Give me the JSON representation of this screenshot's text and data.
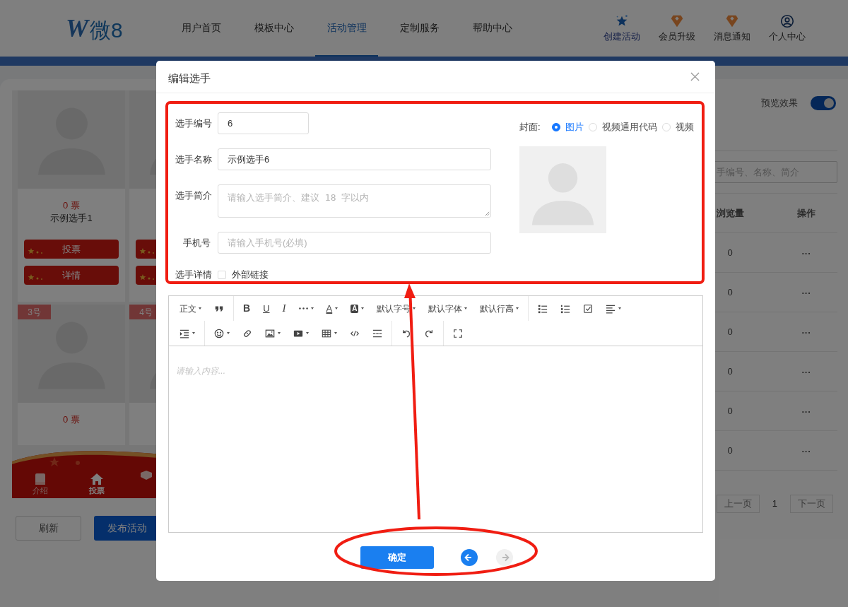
{
  "header": {
    "logo_mark": "W",
    "logo_text": "微8",
    "nav": [
      {
        "label": "用户首页",
        "selected": false
      },
      {
        "label": "模板中心",
        "selected": false
      },
      {
        "label": "活动管理",
        "selected": true
      },
      {
        "label": "定制服务",
        "selected": false
      },
      {
        "label": "帮助中心",
        "selected": false
      }
    ],
    "actions": [
      {
        "label": "创建活动"
      },
      {
        "label": "会员升级"
      },
      {
        "label": "消息通知"
      },
      {
        "label": "个人中心"
      }
    ]
  },
  "preview": {
    "cards": [
      {
        "kind": "full",
        "votes": "0 票",
        "name": "示例选手1",
        "buttons": [
          "投票",
          "详情"
        ]
      },
      {
        "kind": "covered"
      },
      {
        "kind": "badge",
        "badge": "3号",
        "votes": "0 票"
      },
      {
        "kind": "badge",
        "badge": "4号"
      }
    ],
    "tabs": [
      {
        "label": "介绍",
        "selected": false
      },
      {
        "label": "投票",
        "selected": true
      }
    ]
  },
  "actions": {
    "refresh": "刷新",
    "publish": "发布活动"
  },
  "preview_toggle": {
    "label": "预览效果",
    "on": true
  },
  "search": {
    "placeholder": "手编号、名称、简介"
  },
  "table": {
    "columns": [
      "浏览量",
      "操作"
    ],
    "rows": [
      {
        "views": "0",
        "actions": "···"
      },
      {
        "views": "0",
        "actions": "···"
      },
      {
        "views": "0",
        "actions": "···"
      },
      {
        "views": "0",
        "actions": "···"
      },
      {
        "views": "0",
        "actions": "···"
      },
      {
        "views": "0",
        "actions": "···"
      }
    ]
  },
  "pagination": {
    "prev": "上一页",
    "page": "1",
    "next": "下一页"
  },
  "dialog": {
    "title": "编辑选手",
    "fields": [
      {
        "kind": "short",
        "label": "选手编号",
        "value": "6"
      },
      {
        "kind": "text",
        "label": "选手名称",
        "value": "示例选手6"
      },
      {
        "kind": "textarea",
        "label": "选手简介",
        "placeholder": "请输入选手简介、建议 18 字以内"
      },
      {
        "kind": "text",
        "label": "手机号",
        "placeholder": "请输入手机号(必填)"
      }
    ],
    "detail": {
      "label": "选手详情",
      "checkbox": {
        "label": "外部链接",
        "checked": false
      }
    },
    "cover": {
      "label": "封面:",
      "options": [
        {
          "label": "图片",
          "selected": true
        },
        {
          "label": "视频通用代码",
          "selected": false
        },
        {
          "label": "视频",
          "selected": false
        }
      ]
    },
    "editor": {
      "toolbar": [
        [
          {
            "kind": "menu",
            "label": "正文"
          },
          {
            "kind": "icon"
          },
          {
            "kind": "sep"
          },
          {
            "kind": "glyph",
            "label": "B"
          },
          {
            "kind": "glyph",
            "label": "U"
          },
          {
            "kind": "glyph",
            "label": "I"
          },
          {
            "kind": "icon",
            "dropdown": true
          },
          {
            "kind": "glyph",
            "label": "A",
            "dropdown": true
          },
          {
            "kind": "glyph",
            "label": "A",
            "dropdown": true
          },
          {
            "kind": "menu",
            "label": "默认字号"
          },
          {
            "kind": "menu",
            "label": "默认字体"
          },
          {
            "kind": "menu",
            "label": "默认行高"
          },
          {
            "kind": "sep"
          },
          {
            "kind": "icon"
          },
          {
            "kind": "icon"
          },
          {
            "kind": "icon"
          },
          {
            "kind": "icon",
            "dropdown": true
          }
        ],
        [
          {
            "kind": "icon",
            "dropdown": true
          },
          {
            "kind": "sep"
          },
          {
            "kind": "icon",
            "dropdown": true
          },
          {
            "kind": "icon"
          },
          {
            "kind": "icon",
            "dropdown": true
          },
          {
            "kind": "icon",
            "dropdown": true
          },
          {
            "kind": "icon",
            "dropdown": true
          },
          {
            "kind": "icon"
          },
          {
            "kind": "icon"
          },
          {
            "kind": "sep"
          },
          {
            "kind": "icon"
          },
          {
            "kind": "icon"
          },
          {
            "kind": "sep"
          },
          {
            "kind": "icon"
          }
        ]
      ],
      "placeholder": "请输入内容..."
    },
    "confirm": "确定",
    "steps": [
      {
        "disabled": false
      },
      {
        "disabled": true
      }
    ]
  }
}
